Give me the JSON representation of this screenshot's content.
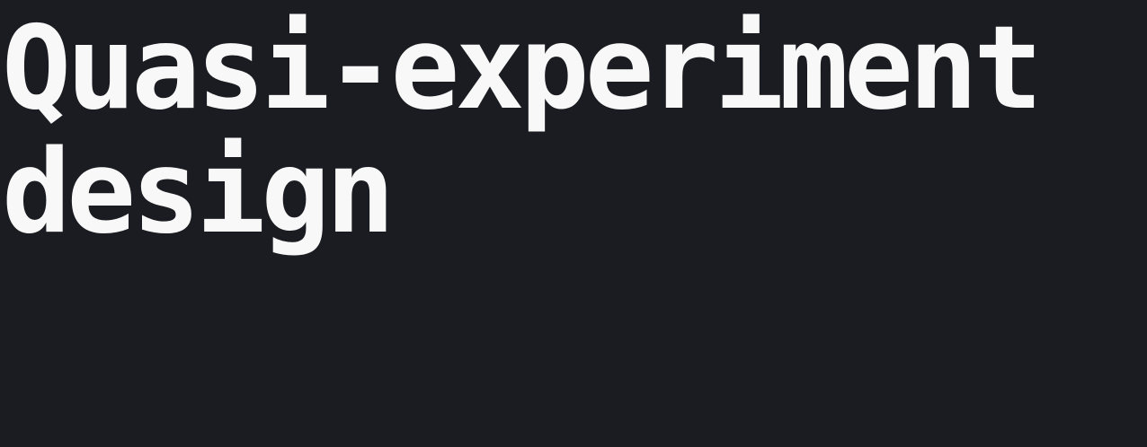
{
  "heading": {
    "line1": "Quasi-experiment",
    "line2": "design"
  },
  "colors": {
    "background": "#1b1c21",
    "text": "#f8f8f8"
  }
}
